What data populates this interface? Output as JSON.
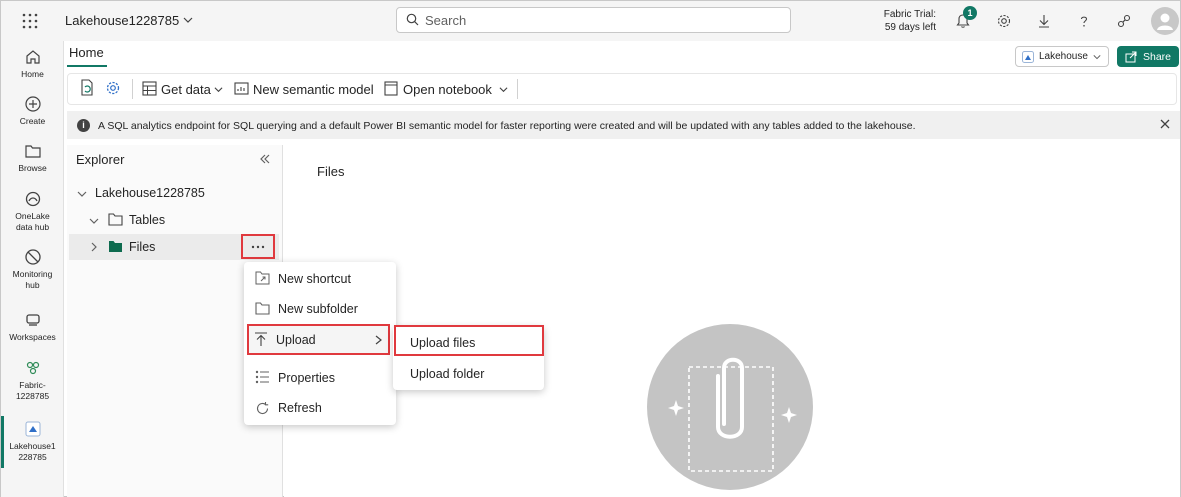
{
  "topbar": {
    "workspace_name": "Lakehouse1228785",
    "search_placeholder": "Search",
    "trial_line1": "Fabric Trial:",
    "trial_line2": "59 days left",
    "notification_count": "1"
  },
  "rail": {
    "home": "Home",
    "create": "Create",
    "browse": "Browse",
    "onelake_1": "OneLake",
    "onelake_2": "data hub",
    "monitoring_1": "Monitoring",
    "monitoring_2": "hub",
    "workspaces": "Workspaces",
    "fabric_1": "Fabric-",
    "fabric_2": "1228785",
    "lakehouse_1": "Lakehouse1",
    "lakehouse_2": "228785"
  },
  "tabs": {
    "home": "Home"
  },
  "header_buttons": {
    "lakehouse": "Lakehouse",
    "share": "Share"
  },
  "ribbon": {
    "get_data": "Get data",
    "new_semantic_model": "New semantic model",
    "open_notebook": "Open notebook"
  },
  "info_bar": {
    "message": "A SQL analytics endpoint for SQL querying and a default Power BI semantic model for faster reporting were created and will be updated with any tables added to the lakehouse."
  },
  "explorer": {
    "title": "Explorer",
    "root": "Lakehouse1228785",
    "tables": "Tables",
    "files": "Files"
  },
  "context_menu": {
    "new_shortcut": "New shortcut",
    "new_subfolder": "New subfolder",
    "upload": "Upload",
    "properties": "Properties",
    "refresh": "Refresh"
  },
  "upload_submenu": {
    "upload_files": "Upload files",
    "upload_folder": "Upload folder"
  },
  "main": {
    "files_header": "Files"
  },
  "colors": {
    "accent": "#117865",
    "highlight": "#e0393e"
  }
}
